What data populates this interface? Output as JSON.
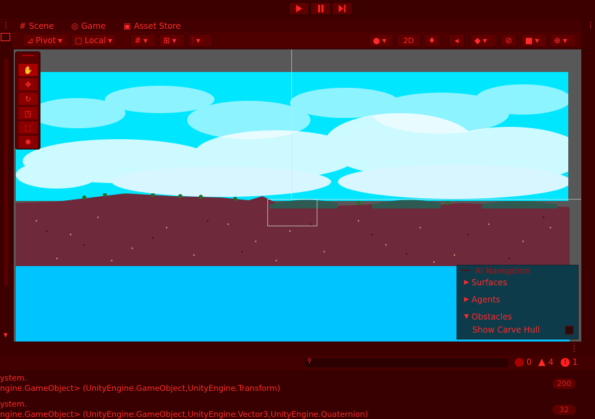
{
  "toolbar_top": {
    "play": "play-icon",
    "pause": "pause-icon",
    "step": "step-icon"
  },
  "tabs": [
    {
      "label": "Scene",
      "icon": "hash-icon"
    },
    {
      "label": "Game",
      "icon": "gamepad-icon"
    },
    {
      "label": "Asset Store",
      "icon": "bag-icon"
    }
  ],
  "scene_toolbar": {
    "pivot": "Pivot",
    "local": "Local",
    "view_2d": "2D"
  },
  "ai_navigation": {
    "title": "AI Navigation",
    "surfaces": "Surfaces",
    "agents": "Agents",
    "obstacles": "Obstacles",
    "show_carve_hull": "Show Carve Hull"
  },
  "console": {
    "search_placeholder": "",
    "counts": {
      "info": "0",
      "warn": "4",
      "error": "1"
    },
    "lines": [
      {
        "line1": "ystem.",
        "line2": "ngine.GameObject> (UnityEngine.GameObject,UnityEngine.Transform)",
        "count": "200"
      },
      {
        "line1": "ystem.",
        "line2": "ngine.GameObject> (UnityEngine.GameObject,UnityEngine.Vector3,UnityEngine.Quaternion)",
        "count": "32"
      }
    ]
  },
  "colors": {
    "accent": "#ff2a2a",
    "sky": "#00e6ff",
    "water": "#00c4ff",
    "ground": "#6e2a3a",
    "bg": "#3a0000"
  }
}
